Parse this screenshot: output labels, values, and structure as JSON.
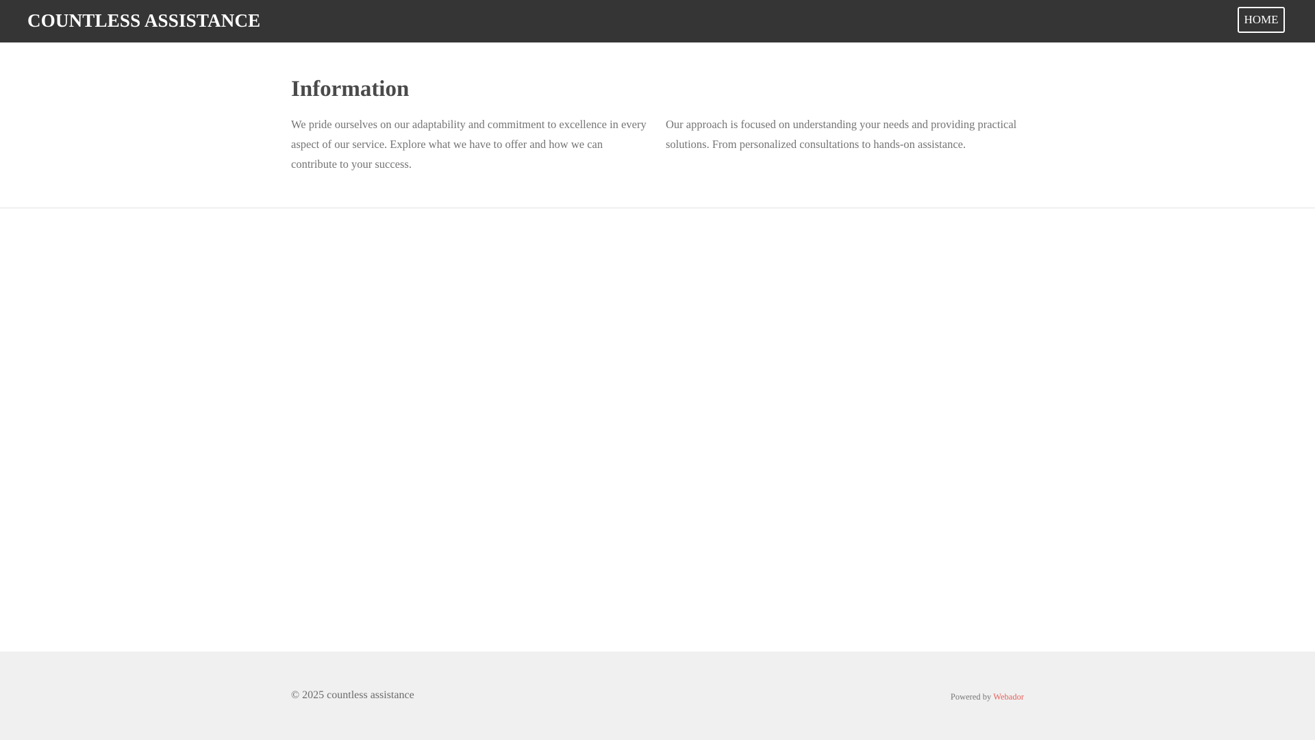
{
  "header": {
    "brand": "COUNTLESS ASSISTANCE",
    "nav": [
      {
        "label": "HOME"
      }
    ]
  },
  "info": {
    "title": "Information",
    "left_text": "We pride ourselves on our adaptability and commitment to excellence in every aspect of our service. Explore what we have to offer and how we can contribute to your success.",
    "right_text": "Our approach is focused on understanding your needs and providing practical solutions. From personalized consultations to hands-on assistance."
  },
  "footer": {
    "copyright": "© 2025 countless assistance",
    "powered_prefix": "Powered by",
    "powered_link": "Webador"
  },
  "colors": {
    "header_bg": "#353535",
    "footer_bg": "#f0f0f0",
    "accent_link": "#e8615a"
  }
}
